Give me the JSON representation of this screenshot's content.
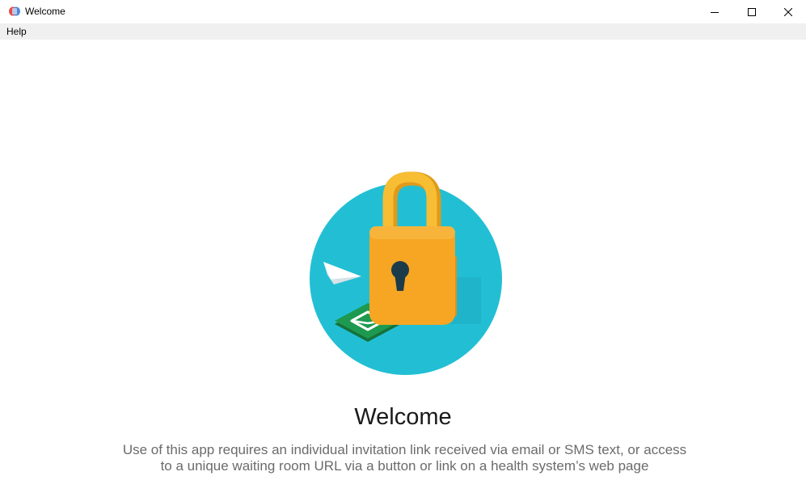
{
  "window": {
    "title": "Welcome",
    "controls": {
      "minimize_icon": "minimize-icon",
      "maximize_icon": "maximize-icon",
      "close_icon": "close-icon"
    }
  },
  "menubar": {
    "items": [
      {
        "label": "Help"
      }
    ]
  },
  "main": {
    "illustration": {
      "icons": [
        "padlock-icon",
        "paper-plane-icon",
        "envelope-icon"
      ],
      "colors": {
        "circle": "#22bfd4",
        "lock_body": "#f6a623",
        "lock_shackle": "#f5b731",
        "keyhole": "#1c3b4a",
        "envelope_tile": "#1b8a4a"
      }
    },
    "heading": "Welcome",
    "description": "Use of this app requires an individual invitation link received via email or SMS text, or access to a unique waiting room URL via a button or link on a health system’s web page"
  }
}
